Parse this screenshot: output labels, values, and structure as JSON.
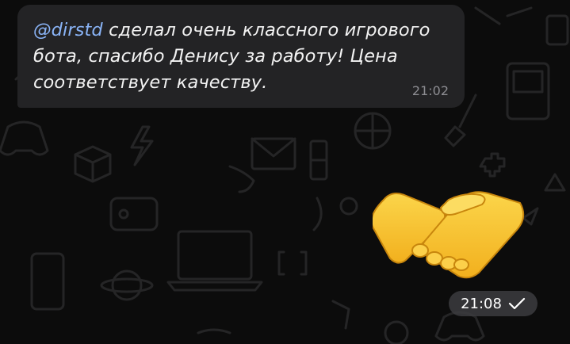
{
  "incoming_message": {
    "mention": "@dirstd",
    "text": " сделал очень классного игрового бота, спасибо Денису за работу! Цена соответствует качеству.",
    "time": "21:02"
  },
  "outgoing_message": {
    "sticker": "handshake-emoji",
    "time": "21:08",
    "status": "sent-check-icon"
  },
  "colors": {
    "background": "#0c0c0c",
    "bubble": "#232325",
    "mention": "#8ab4f7",
    "sticker": "#f5c22b"
  }
}
